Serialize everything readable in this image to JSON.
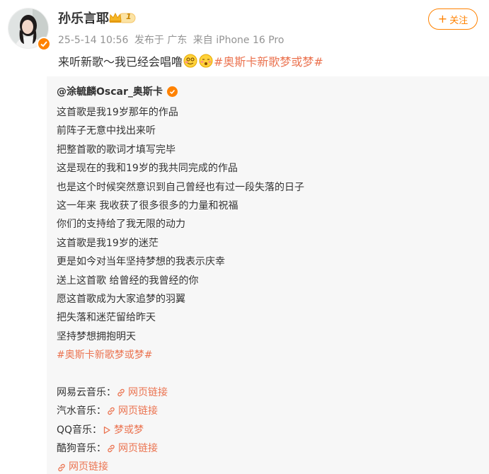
{
  "post": {
    "user_name": "孙乐言耶",
    "vip_level": "1",
    "date": "25-5-14 10:56",
    "location": "发布于 广东",
    "device": "来自 iPhone 16 Pro",
    "follow_label": "关注",
    "text_prefix": "来听新歌～我已经会唱噜",
    "hashtag": "#奥斯卡新歌梦或梦#"
  },
  "repost": {
    "author": "@涂毓麟Oscar_奥斯卡",
    "lines": [
      "这首歌是我19岁那年的作品",
      "前阵子无意中找出来听",
      "把整首歌的歌词才填写完毕",
      "这是现在的我和19岁的我共同完成的作品",
      "也是这个时候突然意识到自己曾经也有过一段失落的日子",
      "这一年来 我收获了很多很多的力量和祝福",
      "你们的支持给了我无限的动力",
      "这首歌是我19岁的迷茫",
      "更是如今对当年坚持梦想的我表示庆幸",
      "送上这首歌 给曾经的我曾经的你",
      "愿这首歌成为大家追梦的羽翼",
      "把失落和迷茫留给昨天",
      "坚持梦想拥抱明天"
    ],
    "hashtag": "#奥斯卡新歌梦或梦#",
    "links": [
      {
        "label": "网易云音乐：",
        "text": "网页链接",
        "icon": "link-icon"
      },
      {
        "label": "汽水音乐：",
        "text": "网页链接",
        "icon": "link-icon"
      },
      {
        "label": "QQ音乐：",
        "text": "梦或梦",
        "icon": "play-icon"
      },
      {
        "label": "酷狗音乐：",
        "text": "网页链接",
        "icon": "link-icon"
      },
      {
        "label": "",
        "text": "网页链接",
        "icon": "link-icon"
      }
    ]
  },
  "colors": {
    "accent": "#ff8200",
    "link": "#eb7350",
    "meta": "#939393",
    "repost_bg": "#f7f7f7"
  }
}
